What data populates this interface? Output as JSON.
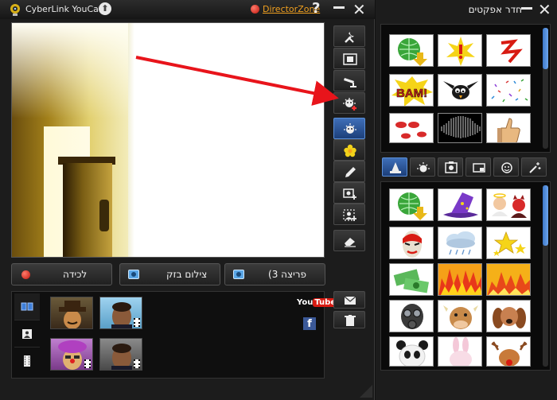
{
  "main_window": {
    "title": "CyberLink YouCam",
    "director_zone": "DirectorZone",
    "help": "?",
    "close": "✕"
  },
  "capture": {
    "record_label": "לכידה",
    "snapshot_label": "צילום בזק",
    "burst_label": "(פריצה 3"
  },
  "share": {
    "youtube": "YouTube",
    "facebook": "f"
  },
  "effects_room": {
    "title": "חדר אפקטים",
    "close": "✕"
  },
  "colors": {
    "accent_blue": "#3f6fb8",
    "record_red": "#d81b12",
    "director_zone_orange": "#f0a020"
  }
}
